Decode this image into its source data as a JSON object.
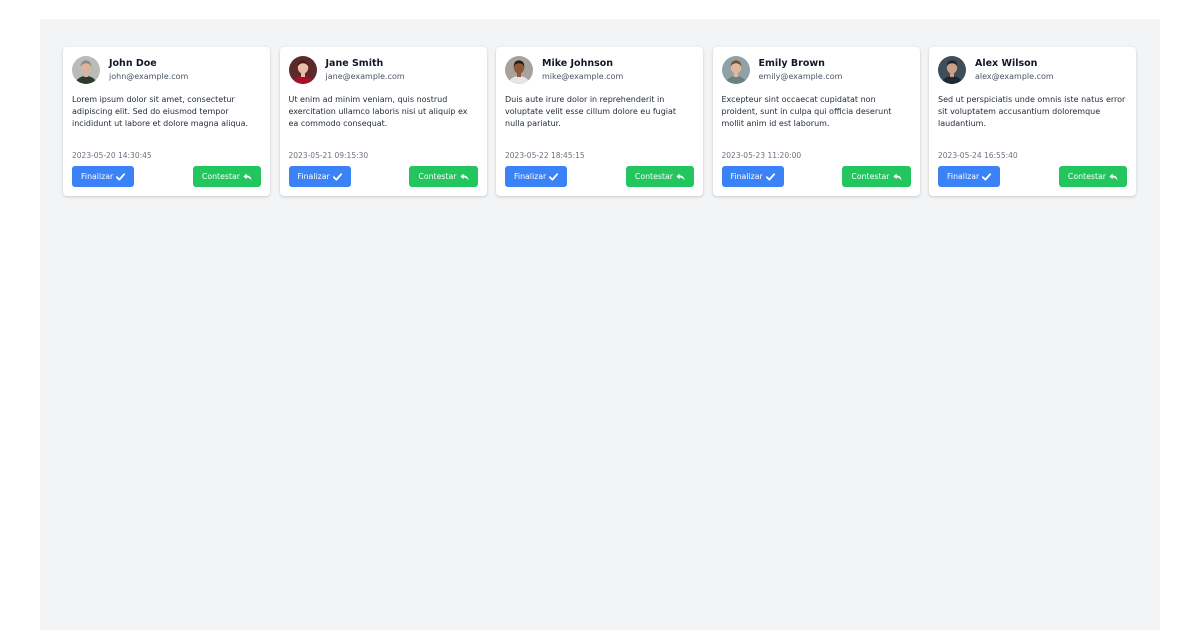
{
  "colors": {
    "background": "#f3f4f6",
    "card": "#ffffff",
    "finish_button": "#3b82f6",
    "reply_button": "#22c55e"
  },
  "cards": [
    {
      "name": "John Doe",
      "email": "john@example.com",
      "message": "Lorem ipsum dolor sit amet, consectetur adipiscing elit. Sed do eiusmod tempor incididunt ut labore et dolore magna aliqua.",
      "timestamp": "2023-05-20 14:30:45",
      "finish_label": "Finalizar",
      "reply_label": "Contestar",
      "avatar": {
        "bg": "#b9bcb8",
        "skin": "#d8b59c",
        "hair": "#8a8a84",
        "shirt": "#2f3a2e"
      }
    },
    {
      "name": "Jane Smith",
      "email": "jane@example.com",
      "message": "Ut enim ad minim veniam, quis nostrud exercitation ullamco laboris nisi ut aliquip ex ea commodo consequat.",
      "timestamp": "2023-05-21 09:15:30",
      "finish_label": "Finalizar",
      "reply_label": "Contestar",
      "avatar": {
        "bg": "#5c2a2a",
        "skin": "#e7bfa5",
        "hair": "#4a1f17",
        "shirt": "#a3122a"
      }
    },
    {
      "name": "Mike Johnson",
      "email": "mike@example.com",
      "message": "Duis aute irure dolor in reprehenderit in voluptate velit esse cillum dolore eu fugiat nulla pariatur.",
      "timestamp": "2023-05-22 18:45:15",
      "finish_label": "Finalizar",
      "reply_label": "Contestar",
      "avatar": {
        "bg": "#a8a29e",
        "skin": "#8a5a3b",
        "hair": "#2b1a10",
        "shirt": "#e7e5e4"
      }
    },
    {
      "name": "Emily Brown",
      "email": "emily@example.com",
      "message": "Excepteur sint occaecat cupidatat non proident, sunt in culpa qui officia deserunt mollit anim id est laborum.",
      "timestamp": "2023-05-23 11:20:00",
      "finish_label": "Finalizar",
      "reply_label": "Contestar",
      "avatar": {
        "bg": "#8fa3a6",
        "skin": "#e0b89b",
        "hair": "#7a4b2e",
        "shirt": "#6b7f84"
      }
    },
    {
      "name": "Alex Wilson",
      "email": "alex@example.com",
      "message": "Sed ut perspiciatis unde omnis iste natus error sit voluptatem accusantium doloremque laudantium.",
      "timestamp": "2023-05-24 16:55:40",
      "finish_label": "Finalizar",
      "reply_label": "Contestar",
      "avatar": {
        "bg": "#3f4e5a",
        "skin": "#caa086",
        "hair": "#2a2320",
        "shirt": "#1f2a33"
      }
    }
  ]
}
